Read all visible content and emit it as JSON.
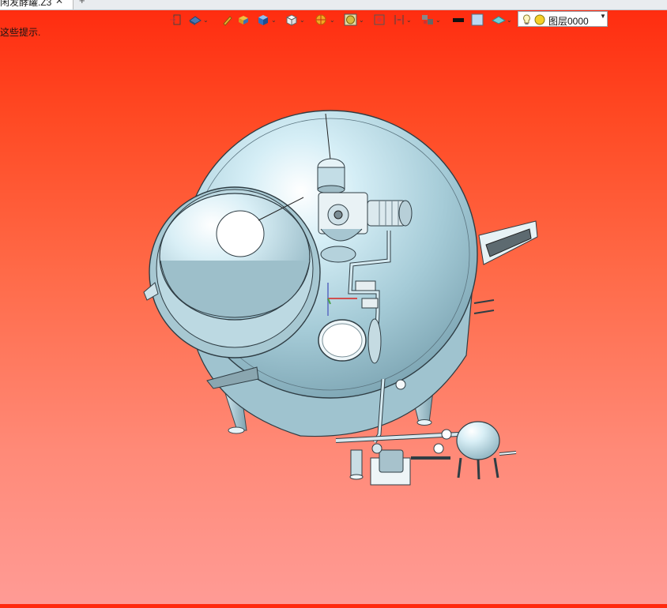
{
  "tab": {
    "title": "闲发酵罐.Z3",
    "close": "✕",
    "new": "+"
  },
  "hint": "这些提示.",
  "toolbar": {
    "items": [
      "insert-icon",
      "view-orient-icon",
      "render-mode-icon",
      "shade-icon",
      "cube-icon",
      "wireframe-icon",
      "section-icon",
      "sphere-icon",
      "zoom-fit-icon",
      "dimension-icon",
      "layout-icon",
      "line-color-swatch",
      "face-color-swatch",
      "plane-icon"
    ],
    "layer": {
      "name": "图层0000",
      "light_color": "#f5d02a"
    }
  },
  "colors": {
    "bg_top": "#ff2a0e",
    "bg_bottom": "#ff9b95",
    "metal": "#a9cedb"
  }
}
